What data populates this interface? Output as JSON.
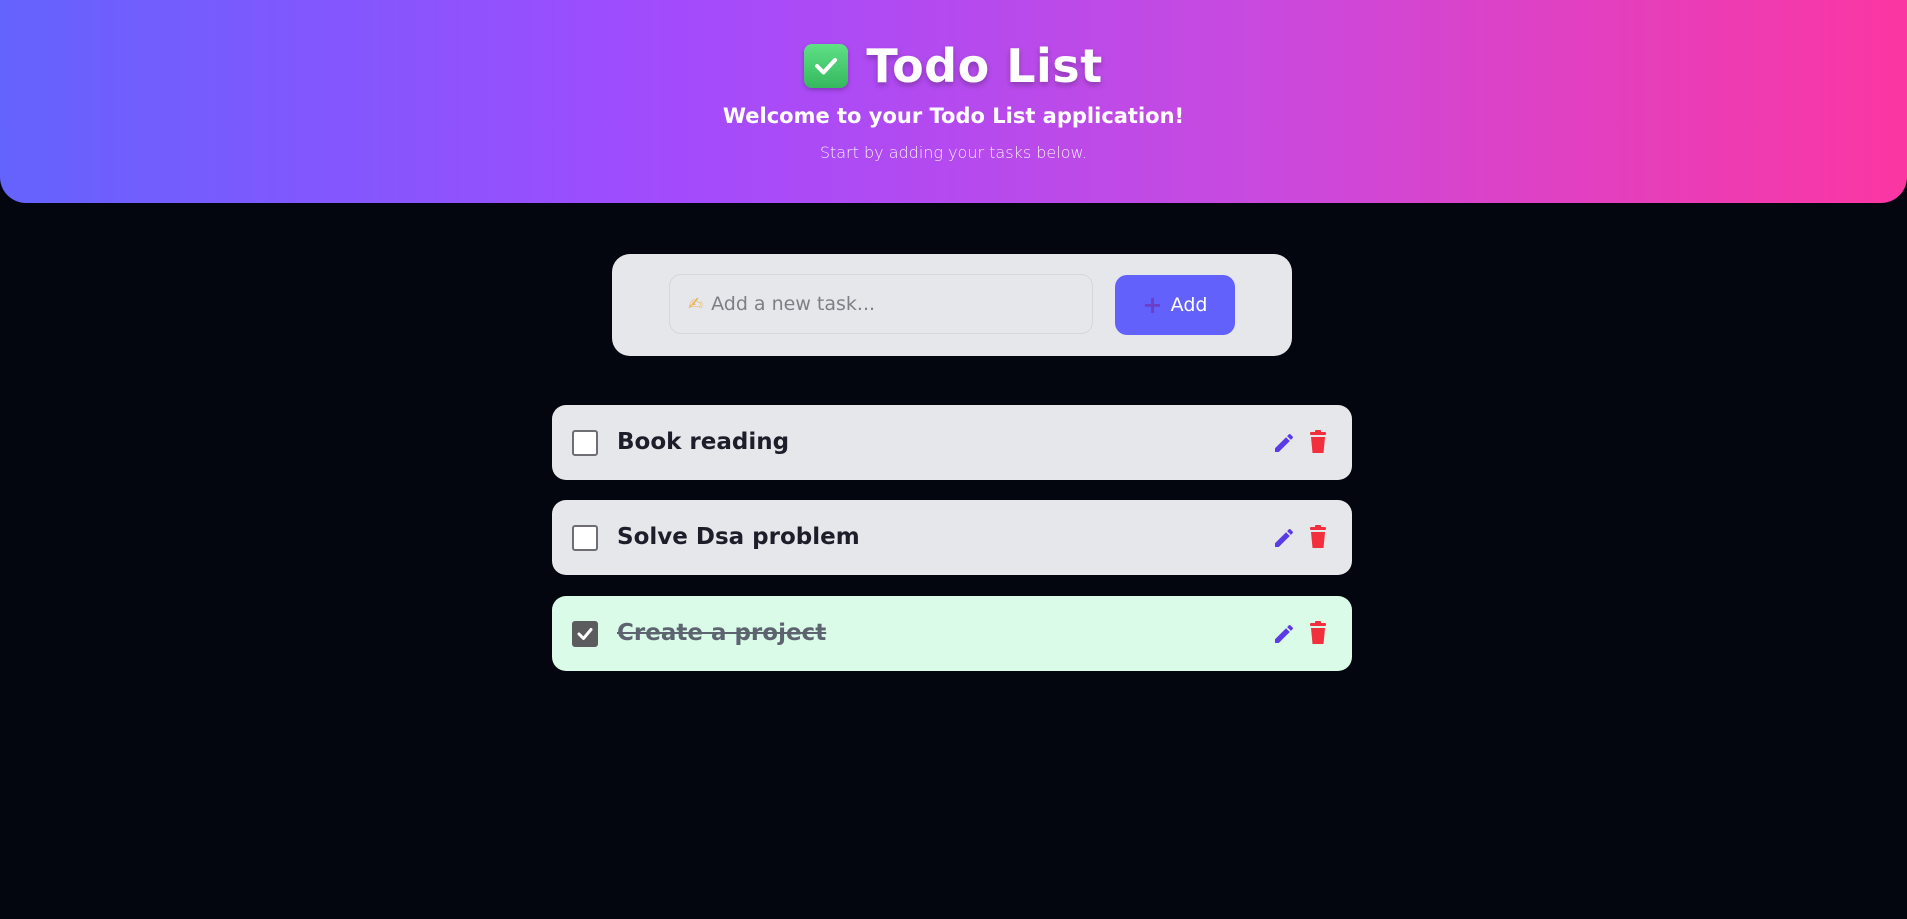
{
  "header": {
    "title": "Todo List",
    "subtitle": "Welcome to your Todo List application!",
    "subtext": "Start by adding your tasks below."
  },
  "add_task": {
    "placeholder": "Add a new task...",
    "button_label": "Add"
  },
  "todos": [
    {
      "text": "Book reading",
      "completed": false
    },
    {
      "text": "Solve Dsa problem",
      "completed": false
    },
    {
      "text": "Create a project",
      "completed": true
    }
  ],
  "icons": {
    "title_icon": "check-box-emoji",
    "input_icon": "writing-hand-icon",
    "add_icon": "plus-icon",
    "edit_icon": "pencil-icon",
    "delete_icon": "trash-icon"
  },
  "colors": {
    "accent": "#6261fb",
    "edit": "#5b3ae8",
    "delete": "#f22f3d",
    "done_bg": "#d9fbe8",
    "background": "#03060f"
  }
}
